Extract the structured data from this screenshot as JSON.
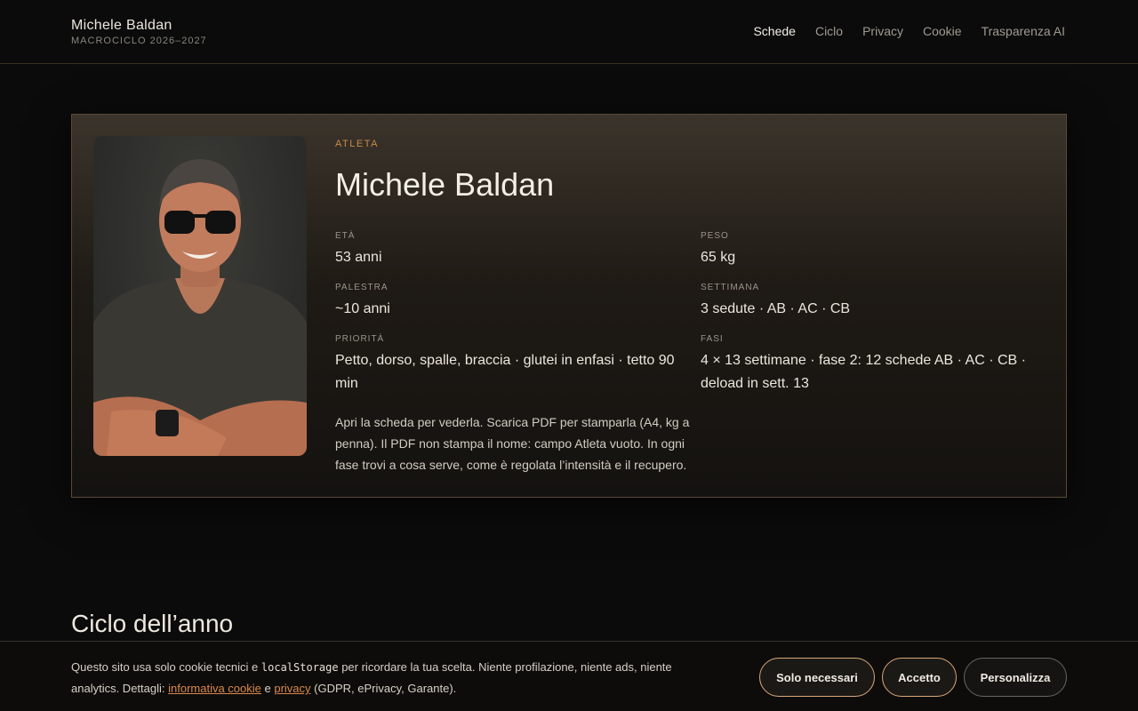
{
  "header": {
    "brand_name": "Michele Baldan",
    "brand_sub": "MACROCICLO 2026–2027",
    "nav": [
      {
        "label": "Schede",
        "active": true
      },
      {
        "label": "Ciclo"
      },
      {
        "label": "Privacy"
      },
      {
        "label": "Cookie"
      },
      {
        "label": "Trasparenza AI"
      }
    ]
  },
  "athlete": {
    "kicker": "ATLETA",
    "name": "Michele Baldan",
    "fields": {
      "eta": {
        "label": "ETÀ",
        "value": "53 anni"
      },
      "peso": {
        "label": "PESO",
        "value": "65 kg"
      },
      "palestra": {
        "label": "PALESTRA",
        "value": "~10 anni"
      },
      "settimana": {
        "label": "SETTIMANA",
        "value": "3 sedute · AB · AC · CB"
      },
      "priorita": {
        "label": "PRIORITÀ",
        "value": "Petto, dorso, spalle, braccia · glutei in enfasi · tetto 90 min"
      },
      "fasi": {
        "label": "FASI",
        "value": "4 × 13 settimane · fase 2: 12 schede AB · AC · CB · deload in sett. 13"
      }
    },
    "note": "Apri la scheda per vederla. Scarica PDF per stamparla (A4, kg a penna). Il PDF non stampa il nome: campo Atleta vuoto. In ogni fase trovi a cosa serve, come è regolata l’intensità e il recupero."
  },
  "section": {
    "title": "Ciclo dell’anno"
  },
  "cookie": {
    "text_1": "Questo sito usa solo cookie tecnici e ",
    "code": "localStorage",
    "text_2": " per ricordare la tua scelta. Niente profilazione, niente ads, niente analytics. Dettagli: ",
    "link_cookie": "informativa cookie",
    "text_3": " e ",
    "link_privacy": "privacy",
    "text_4": " (GDPR, ePrivacy, Garante).",
    "btn_necessari": "Solo necessari",
    "btn_accetto": "Accetto",
    "btn_personalizza": "Personalizza"
  }
}
